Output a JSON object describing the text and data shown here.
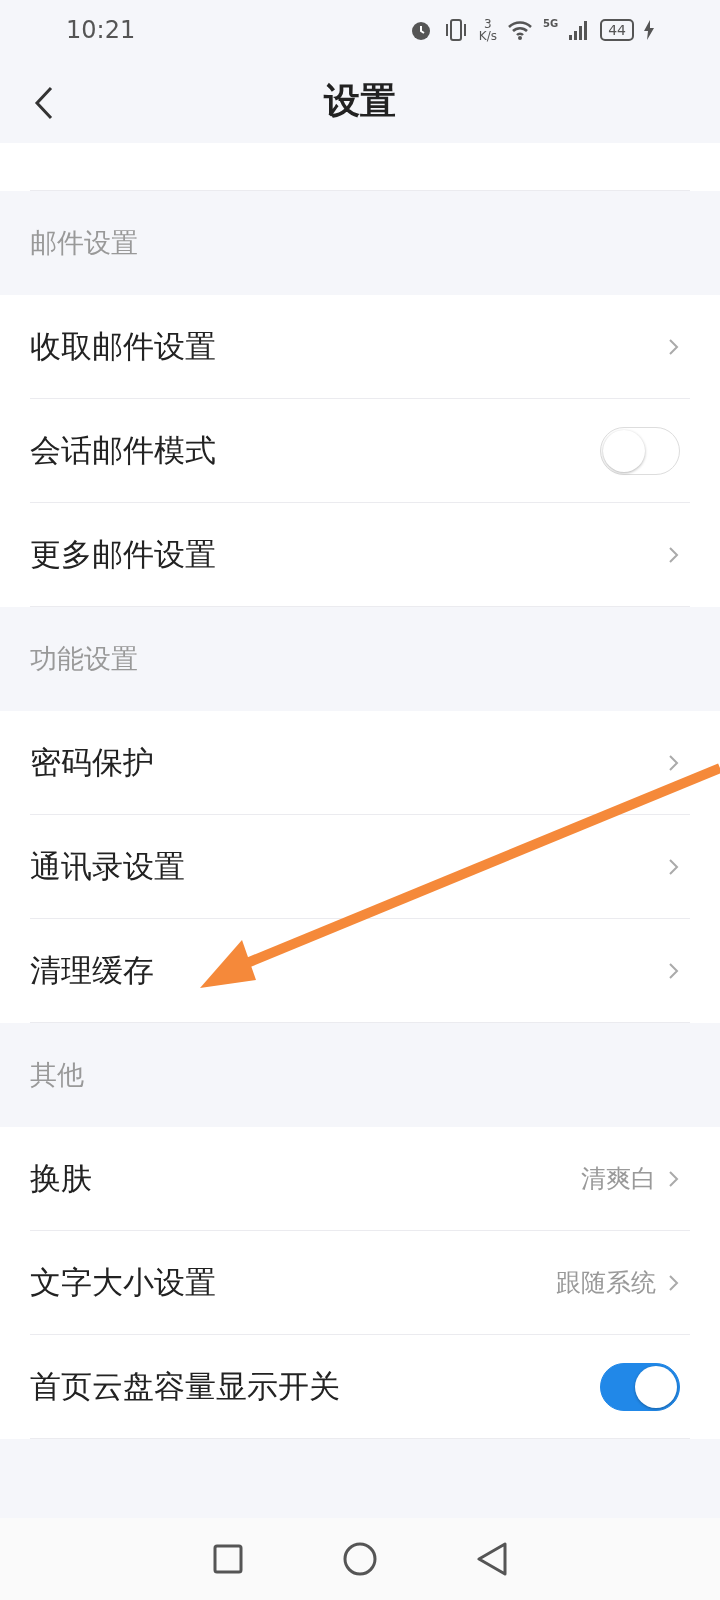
{
  "status_bar": {
    "time": "10:21",
    "speed_value": "3",
    "speed_unit": "K/s",
    "network": "5G",
    "battery": "44"
  },
  "header": {
    "title": "设置"
  },
  "sections": [
    {
      "title": "邮件设置",
      "items": [
        {
          "kind": "link",
          "label": "收取邮件设置"
        },
        {
          "kind": "toggle",
          "label": "会话邮件模式",
          "on": false
        },
        {
          "kind": "link",
          "label": "更多邮件设置"
        }
      ]
    },
    {
      "title": "功能设置",
      "items": [
        {
          "kind": "link",
          "label": "密码保护"
        },
        {
          "kind": "link",
          "label": "通讯录设置"
        },
        {
          "kind": "link",
          "label": "清理缓存"
        }
      ]
    },
    {
      "title": "其他",
      "items": [
        {
          "kind": "link",
          "label": "换肤",
          "value": "清爽白"
        },
        {
          "kind": "link",
          "label": "文字大小设置",
          "value": "跟随系统"
        },
        {
          "kind": "toggle",
          "label": "首页云盘容量显示开关",
          "on": true
        }
      ]
    }
  ]
}
